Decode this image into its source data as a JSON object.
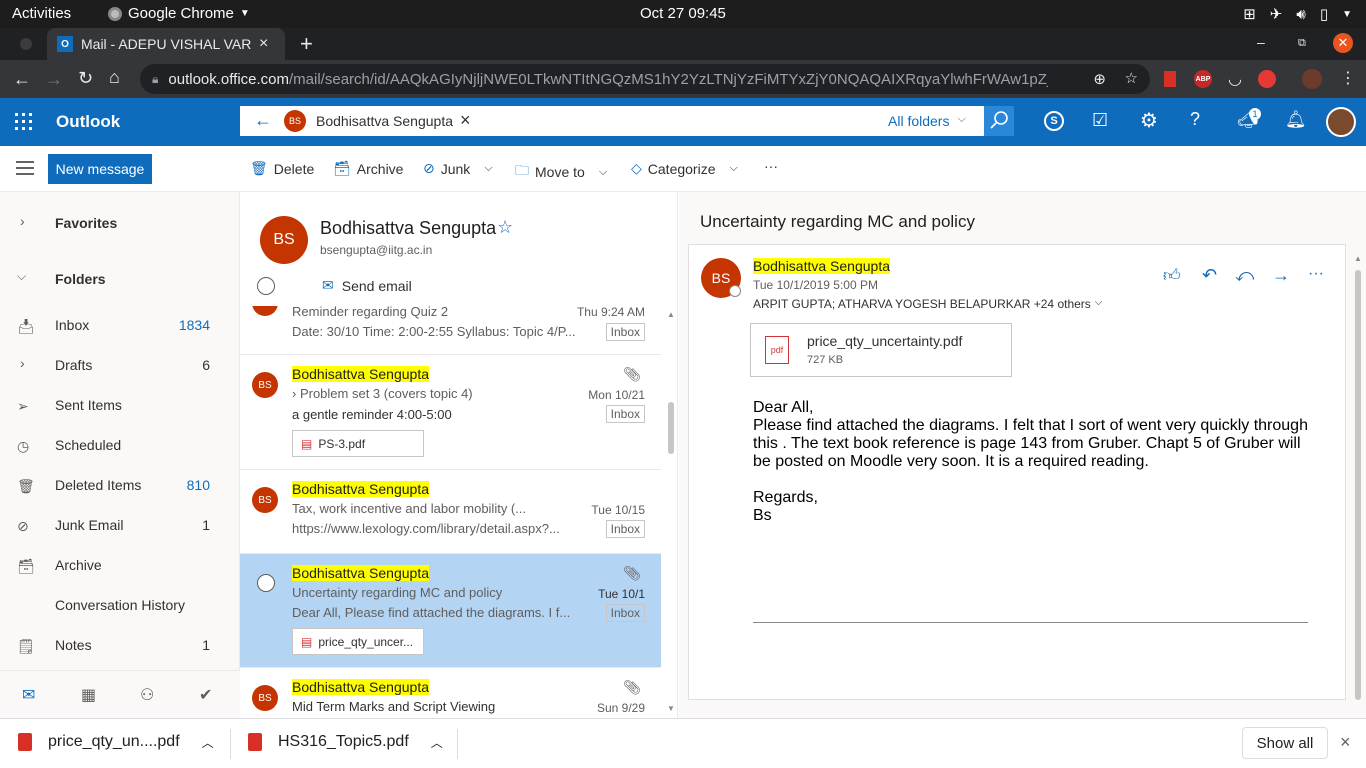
{
  "system": {
    "activities": "Activities",
    "app_name": "Google Chrome",
    "clock": "Oct 27  09:45"
  },
  "browser": {
    "tab_title": "Mail - ADEPU VISHAL VAR",
    "url_domain": "outlook.office.com",
    "url_path": "/mail/search/id/AAQkAGIyNjljNWE0LTkwNTItNGQzMS1hY2YzLTNjYzFiMTYxZjY0NQAQAIXRqyaYlwhFrWAw1pZjv84%3D",
    "ext_abp": "ABP"
  },
  "outlook": {
    "brand": "Outlook",
    "search_chip_initials": "BS",
    "search_chip_name": "Bodhisattva Sengupta",
    "search_scope": "All folders",
    "notification_count": "1"
  },
  "commands": {
    "new_message": "New message",
    "delete": "Delete",
    "archive": "Archive",
    "junk": "Junk",
    "move_to": "Move to",
    "categorize": "Categorize",
    "more": "···"
  },
  "nav": {
    "favorites": "Favorites",
    "folders": "Folders",
    "items": [
      {
        "label": "Inbox",
        "count": "1834"
      },
      {
        "label": "Drafts",
        "count": "6"
      },
      {
        "label": "Sent Items",
        "count": ""
      },
      {
        "label": "Scheduled",
        "count": ""
      },
      {
        "label": "Deleted Items",
        "count": "810"
      },
      {
        "label": "Junk Email",
        "count": "1"
      },
      {
        "label": "Archive",
        "count": ""
      },
      {
        "label": "Conversation History",
        "count": ""
      },
      {
        "label": "Notes",
        "count": "1"
      }
    ]
  },
  "contact": {
    "initials": "BS",
    "name": "Bodhisattva Sengupta",
    "email": "bsengupta@iitg.ac.in",
    "send_email": "Send email"
  },
  "messages": [
    {
      "subject": "Reminder regarding Quiz 2",
      "date": "Thu 9:24 AM",
      "preview": "Date: 30/10 Time: 2:00-2:55 Syllabus: Topic 4/P...",
      "folder": "Inbox"
    },
    {
      "initials": "BS",
      "sender": "Bodhisattva Sengupta",
      "subject": "Problem set 3 (covers topic 4)",
      "date": "Mon 10/21",
      "preview": "a gentle reminder 4:00-5:00",
      "folder": "Inbox",
      "attachment": "PS-3.pdf"
    },
    {
      "initials": "BS",
      "sender": "Bodhisattva Sengupta",
      "subject": "Tax, work incentive and labor mobility (...",
      "date": "Tue 10/15",
      "preview": "https://www.lexology.com/library/detail.aspx?...",
      "folder": "Inbox"
    },
    {
      "sender": "Bodhisattva Sengupta",
      "subject": "Uncertainty regarding MC and policy",
      "date": "Tue 10/1",
      "preview": "Dear All, Please find attached the diagrams. I f...",
      "folder": "Inbox",
      "attachment": "price_qty_uncer..."
    },
    {
      "initials": "BS",
      "sender": "Bodhisattva Sengupta",
      "subject": "Mid Term Marks and Script Viewing",
      "date": "Sun 9/29"
    }
  ],
  "reading": {
    "subject": "Uncertainty regarding MC and policy",
    "initials": "BS",
    "sender": "Bodhisattva Sengupta",
    "datetime": "Tue 10/1/2019 5:00 PM",
    "recipients": "ARPIT GUPTA; ATHARVA YOGESH BELAPURKAR +24 others",
    "attachment_name": "price_qty_uncertainty.pdf",
    "attachment_size": "727 KB",
    "attachment_icon_label": "pdf",
    "body_greeting": "Dear All,",
    "body_text": "Please find attached the diagrams. I felt that I sort of went very quickly through this . The text book reference is page 143 from Gruber. Chapt 5 of Gruber will be posted on Moodle very soon. It is a required reading.",
    "body_regards": "Regards,",
    "body_sign": "Bs"
  },
  "downloads": {
    "file1": "price_qty_un....pdf",
    "file2": "HS316_Topic5.pdf",
    "show_all": "Show all"
  },
  "colors": {
    "outlook_blue": "#0f6cbd",
    "avatar_orange": "#c43501",
    "selected_row": "#b4d4f4",
    "highlight": "#ffff00"
  }
}
